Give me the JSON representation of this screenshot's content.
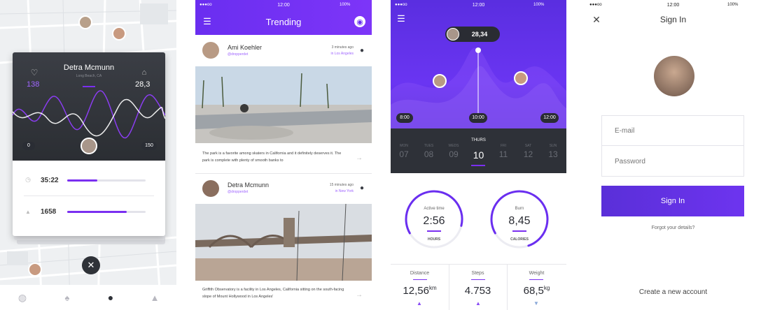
{
  "colors": {
    "accent": "#7b2ff7",
    "accent2": "#5b2bd8",
    "dark": "#2f3238"
  },
  "s1": {
    "name": "Detra Mcmunn",
    "location": "Long Beach, CA",
    "left_value": "138",
    "right_value": "28,3",
    "scale_min": "0",
    "scale_max": "150",
    "rows": [
      {
        "value": "35:22",
        "progress": 0.38
      },
      {
        "value": "1658",
        "progress": 0.76
      }
    ],
    "nav": [
      "globe-icon",
      "flame-icon",
      "location-pin-icon",
      "bell-icon"
    ]
  },
  "s2": {
    "status": {
      "carrier": "●●●oo",
      "time": "12:00",
      "battery": "100%"
    },
    "title": "Trending",
    "posts": [
      {
        "name": "Ami Koehler",
        "handle": "@dropperdet",
        "time": "3 minutes ago",
        "place": "in Los Angeles",
        "text": "The park is a favorite among skaters in California and it definitely deserves it. The park is complete with plenty of smooth banks to"
      },
      {
        "name": "Detra Mcmunn",
        "handle": "@dropperdet",
        "time": "15 minutes ago",
        "place": "in New York",
        "text": "Griffith Observatory is a facility in Los Angeles, California sitting on the south-facing slope of Mount Hollywood in Los Angeles'"
      }
    ]
  },
  "s3": {
    "status": {
      "carrier": "●●●oo",
      "time": "12:00",
      "battery": "100%"
    },
    "peak_value": "28,34",
    "timeline": [
      "8:00",
      "10:00",
      "12:00"
    ],
    "day_label": "THURS",
    "days": [
      {
        "d": "MON",
        "n": "07"
      },
      {
        "d": "TUES",
        "n": "08"
      },
      {
        "d": "WEDS",
        "n": "09"
      },
      {
        "d": "",
        "n": "10"
      },
      {
        "d": "FRI",
        "n": "11"
      },
      {
        "d": "SAT",
        "n": "12"
      },
      {
        "d": "SUN",
        "n": "13"
      }
    ],
    "rings": [
      {
        "label": "Active time",
        "value": "2:56",
        "unit": "HOURS",
        "progress": 0.62
      },
      {
        "label": "Burn",
        "value": "8,45",
        "unit": "CALORIES",
        "progress": 0.78
      }
    ],
    "stats": [
      {
        "label": "Distance",
        "value": "12,56",
        "unit": "km"
      },
      {
        "label": "Steps",
        "value": "4.753",
        "unit": ""
      },
      {
        "label": "Weight",
        "value": "68,5",
        "unit": "kg"
      }
    ]
  },
  "s4": {
    "status": {
      "carrier": "●●●oo",
      "time": "12:00",
      "battery": "100%"
    },
    "title": "Sign In",
    "email_placeholder": "E-mail",
    "password_placeholder": "Password",
    "button": "Sign In",
    "forgot": "Forgot your details?",
    "create": "Create a new account"
  }
}
